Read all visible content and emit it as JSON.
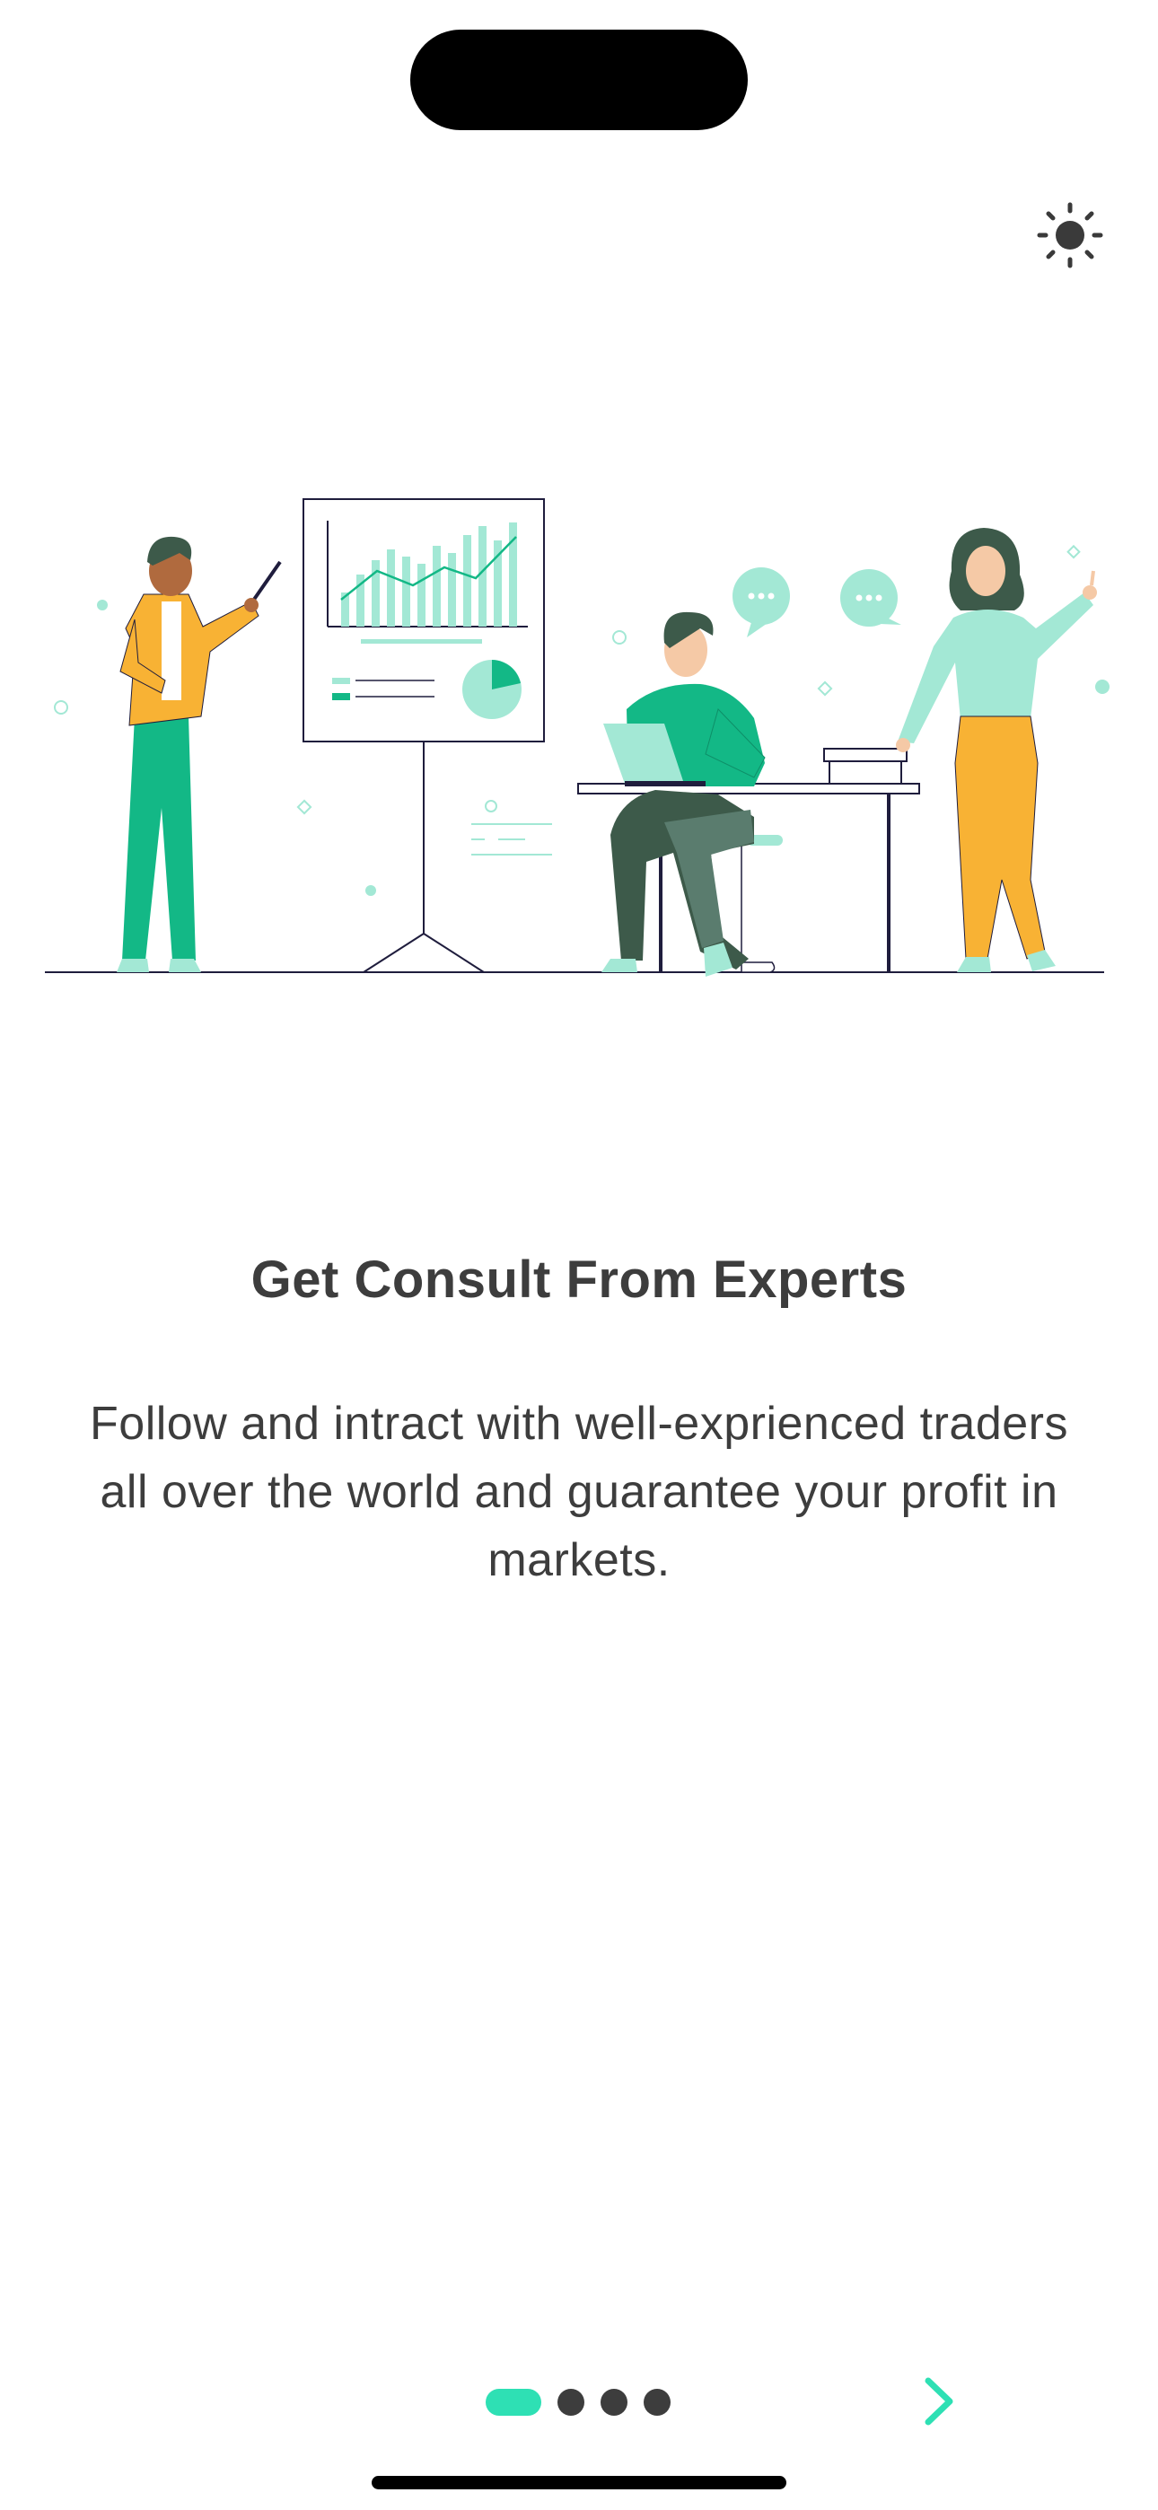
{
  "header": {
    "theme_toggle_icon": "sun-icon"
  },
  "onboarding": {
    "title": "Get Consult From Experts",
    "description": "Follow and intract with well-exprienced traders all over the world and guarantee your profit in markets.",
    "illustration": "experts-consulting-illustration"
  },
  "pager": {
    "total_pages": 4,
    "current_page": 1
  },
  "navigation": {
    "next_icon": "chevron-right-icon"
  },
  "colors": {
    "accent": "#2ee0b4",
    "accent_light": "#a3e8d5",
    "accent_dark": "#13b886",
    "text": "#3d3d3d",
    "orange": "#f8b234",
    "background": "#ffffff"
  }
}
